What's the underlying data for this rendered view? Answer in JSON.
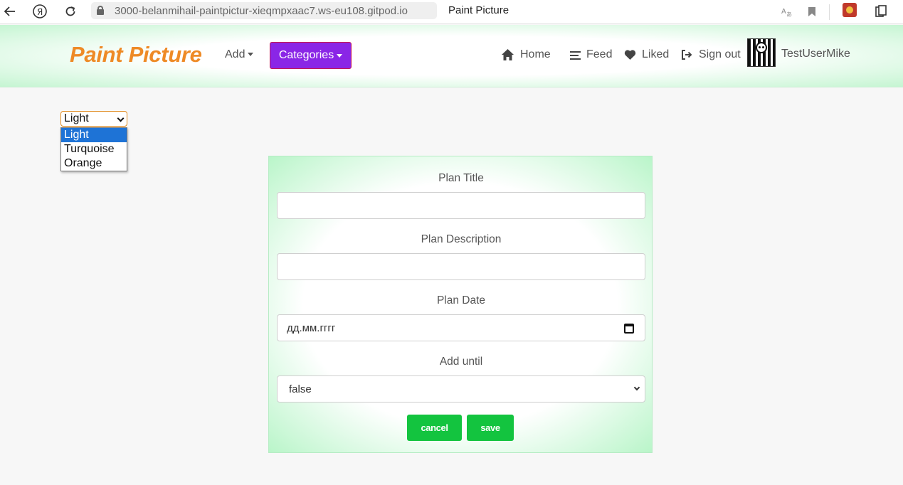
{
  "browser": {
    "url": "3000-belanmihail-paintpictur-xieqmpxaac7.ws-eu108.gitpod.io",
    "tab_title": "Paint Picture",
    "icons": [
      "back-icon",
      "yandex-icon",
      "reload-icon",
      "lock-icon",
      "translate-icon",
      "bookmark-icon",
      "extension-icon",
      "collections-icon"
    ]
  },
  "navbar": {
    "brand": "Paint Picture",
    "add_label": "Add",
    "categories_label": "Categories",
    "links": [
      {
        "label": "Home",
        "icon": "home-icon"
      },
      {
        "label": "Feed",
        "icon": "feed-icon"
      },
      {
        "label": "Liked",
        "icon": "heart-icon"
      },
      {
        "label": "Sign out",
        "icon": "sign-out-icon"
      }
    ],
    "username": "TestUserMike",
    "brand_color": "#ee8a26",
    "categories_color": "#8a26e6"
  },
  "theme": {
    "selected": "Light",
    "options": [
      "Light",
      "Turquoise",
      "Orange"
    ]
  },
  "form": {
    "title_label": "Plan Title",
    "title_value": "",
    "description_label": "Plan Description",
    "description_value": "",
    "date_label": "Plan Date",
    "date_placeholder": "дд.мм.гггг",
    "until_label": "Add until",
    "until_value": "false",
    "cancel_label": "cancel",
    "save_label": "save",
    "button_color": "#13c43f"
  }
}
